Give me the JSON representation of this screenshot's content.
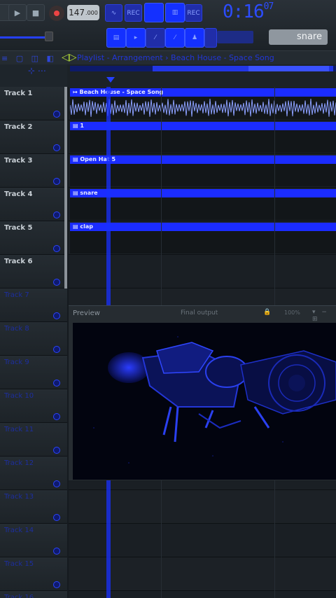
{
  "toolbar": {
    "tempo_value": "147",
    "tempo_decimal": ".000",
    "time_main": "0:16",
    "time_sub": "07",
    "pattern_selected": "snare"
  },
  "playlist": {
    "title": "Playlist - Arrangement › Beach House - Space Song",
    "tools": "≡ ▢ ◫ ◧"
  },
  "tracks": [
    {
      "name": "Track 1",
      "clip": "Beach House - Space Song",
      "clip_type": "audio"
    },
    {
      "name": "Track 2",
      "clip": "1",
      "clip_type": "pattern"
    },
    {
      "name": "Track 3",
      "clip": "Open Hat 5",
      "clip_type": "pattern"
    },
    {
      "name": "Track 4",
      "clip": "snare",
      "clip_type": "pattern"
    },
    {
      "name": "Track 5",
      "clip": "clap",
      "clip_type": "pattern"
    },
    {
      "name": "Track 6",
      "clip": "",
      "clip_type": "none"
    },
    {
      "name": "Track 7",
      "clip": "",
      "clip_type": "none"
    },
    {
      "name": "Track 8",
      "clip": "",
      "clip_type": "none"
    },
    {
      "name": "Track 9",
      "clip": "",
      "clip_type": "none"
    },
    {
      "name": "Track 10",
      "clip": "",
      "clip_type": "none"
    },
    {
      "name": "Track 11",
      "clip": "",
      "clip_type": "none"
    },
    {
      "name": "Track 12",
      "clip": "",
      "clip_type": "none"
    },
    {
      "name": "Track 13",
      "clip": "",
      "clip_type": "none"
    },
    {
      "name": "Track 14",
      "clip": "",
      "clip_type": "none"
    },
    {
      "name": "Track 15",
      "clip": "",
      "clip_type": "none"
    },
    {
      "name": "Track 16",
      "clip": "",
      "clip_type": "none"
    }
  ],
  "preview": {
    "title": "Preview",
    "output": "Final output",
    "zoom": "100%"
  },
  "colors": {
    "accent": "#1b2cff",
    "bg": "#151a1f",
    "track_label": "#c9d0d6"
  },
  "icons": [
    "play-icon",
    "stop-icon",
    "record-icon",
    "lock-icon",
    "settings-icon"
  ]
}
